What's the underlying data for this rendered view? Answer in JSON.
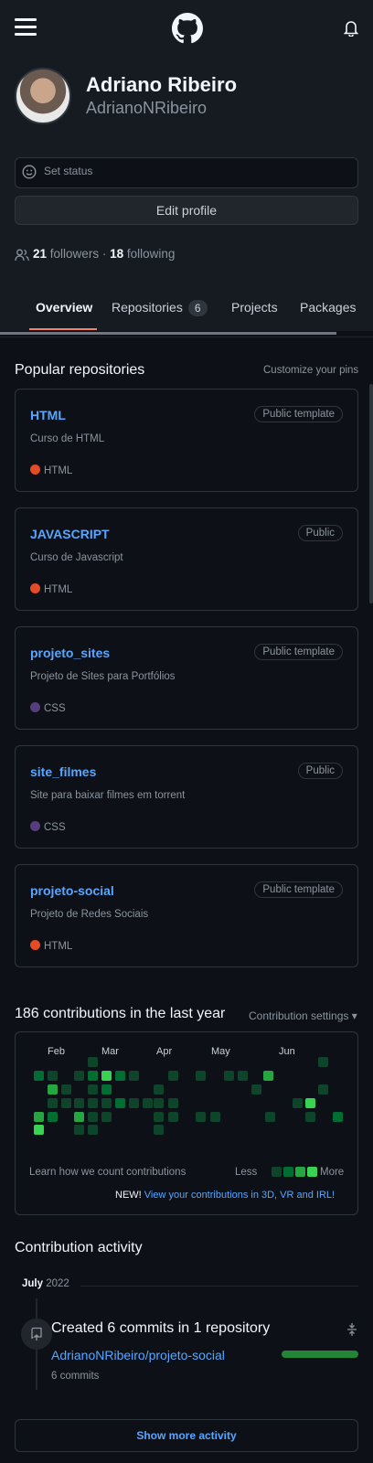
{
  "header": {
    "menu_icon": "hamburger-icon",
    "logo_icon": "github-logo-icon",
    "notification_icon": "bell-icon"
  },
  "profile": {
    "name": "Adriano Ribeiro",
    "username": "AdrianoNRibeiro",
    "status_placeholder": "Set status",
    "edit_profile_label": "Edit profile",
    "followers_count": "21",
    "followers_label": "followers",
    "separator": "·",
    "following_count": "18",
    "following_label": "following"
  },
  "tabs": [
    {
      "label": "Overview",
      "active": true
    },
    {
      "label": "Repositories",
      "count": "6"
    },
    {
      "label": "Projects"
    },
    {
      "label": "Packages"
    }
  ],
  "popular": {
    "title": "Popular repositories",
    "customize_label": "Customize your pins",
    "repos": [
      {
        "name": "HTML",
        "visibility": "Public template",
        "description": "Curso de HTML",
        "language": "HTML",
        "lang_color": "#e34c26"
      },
      {
        "name": "JAVASCRIPT",
        "visibility": "Public",
        "description": "Curso de Javascript",
        "language": "HTML",
        "lang_color": "#e34c26"
      },
      {
        "name": "projeto_sites",
        "visibility": "Public template",
        "description": "Projeto de Sites para Portfólios",
        "language": "CSS",
        "lang_color": "#563d7c"
      },
      {
        "name": "site_filmes",
        "visibility": "Public",
        "description": "Site para baixar filmes em torrent",
        "language": "CSS",
        "lang_color": "#563d7c"
      },
      {
        "name": "projeto-social",
        "visibility": "Public template",
        "description": "Projeto de Redes Sociais",
        "language": "HTML",
        "lang_color": "#e34c26"
      }
    ]
  },
  "contributions": {
    "title": "186 contributions in the last year",
    "settings_label": "Contribution settings ▾",
    "months": [
      "Feb",
      "Mar",
      "Apr",
      "May",
      "Jun"
    ],
    "learn_label": "Learn how we count contributions",
    "less_label": "Less",
    "more_label": "More",
    "new_label": "NEW!",
    "new_link": "View your contributions in 3D, VR and IRL!",
    "level_colors": [
      "#0e4429",
      "#006d32",
      "#26a641",
      "#39d353"
    ]
  },
  "activity": {
    "title": "Contribution activity",
    "month": "July",
    "year": "2022",
    "commit_title": "Created 6 commits in 1 repository",
    "commit_repo": "AdrianoNRibeiro/projeto-social",
    "commit_count": "6 commits",
    "show_more_label": "Show more activity"
  }
}
